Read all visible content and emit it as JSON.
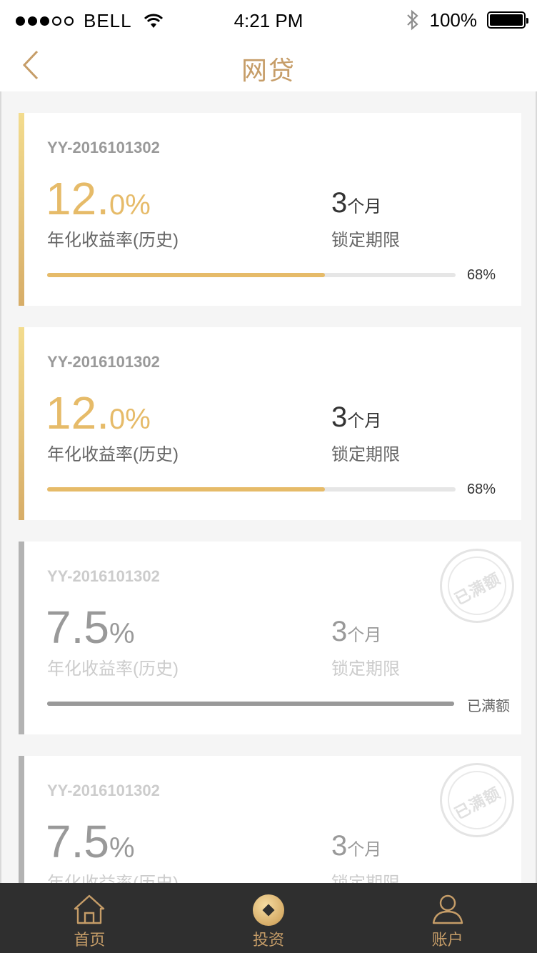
{
  "status_bar": {
    "carrier": "BELL",
    "time": "4:21 PM",
    "battery_percent": "100%",
    "battery_level": 1.0,
    "signal_bars_filled": 3,
    "signal_bars_total": 5
  },
  "nav": {
    "title": "网贷",
    "back_icon": "chevron-left-icon"
  },
  "colors": {
    "accent": "#c69d68",
    "gold": "#e6bb69",
    "background": "#f5f5f5",
    "track": "#e6e6e6",
    "tabbar": "#2f2f2f"
  },
  "products": [
    {
      "code": "YY-2016101302",
      "rate_main": "12.",
      "rate_suffix": "0%",
      "rate_label": "年化收益率(历史)",
      "term_value": "3",
      "term_unit": "个月",
      "term_label": "锁定期限",
      "progress_fraction": 0.68,
      "progress_text": "68%",
      "status": "active"
    },
    {
      "code": "YY-2016101302",
      "rate_main": "12.",
      "rate_suffix": "0%",
      "rate_label": "年化收益率(历史)",
      "term_value": "3",
      "term_unit": "个月",
      "term_label": "锁定期限",
      "progress_fraction": 0.68,
      "progress_text": "68%",
      "status": "active"
    },
    {
      "code": "YY-2016101302",
      "rate_main": "7.5",
      "rate_suffix": "%",
      "rate_label": "年化收益率(历史)",
      "term_value": "3",
      "term_unit": "个月",
      "term_label": "锁定期限",
      "progress_fraction": 1.0,
      "full_text": "已满额",
      "stamp_text": "已满额",
      "status": "full"
    },
    {
      "code": "YY-2016101302",
      "rate_main": "7.5",
      "rate_suffix": "%",
      "rate_label": "年化收益率(历史)",
      "term_value": "3",
      "term_unit": "个月",
      "term_label": "锁定期限",
      "stamp_text": "已满额",
      "status": "full"
    }
  ],
  "tabbar": {
    "items": [
      {
        "label": "首页",
        "icon": "home-icon"
      },
      {
        "label": "投资",
        "icon": "invest-coin-icon"
      },
      {
        "label": "账户",
        "icon": "account-user-icon"
      }
    ]
  }
}
